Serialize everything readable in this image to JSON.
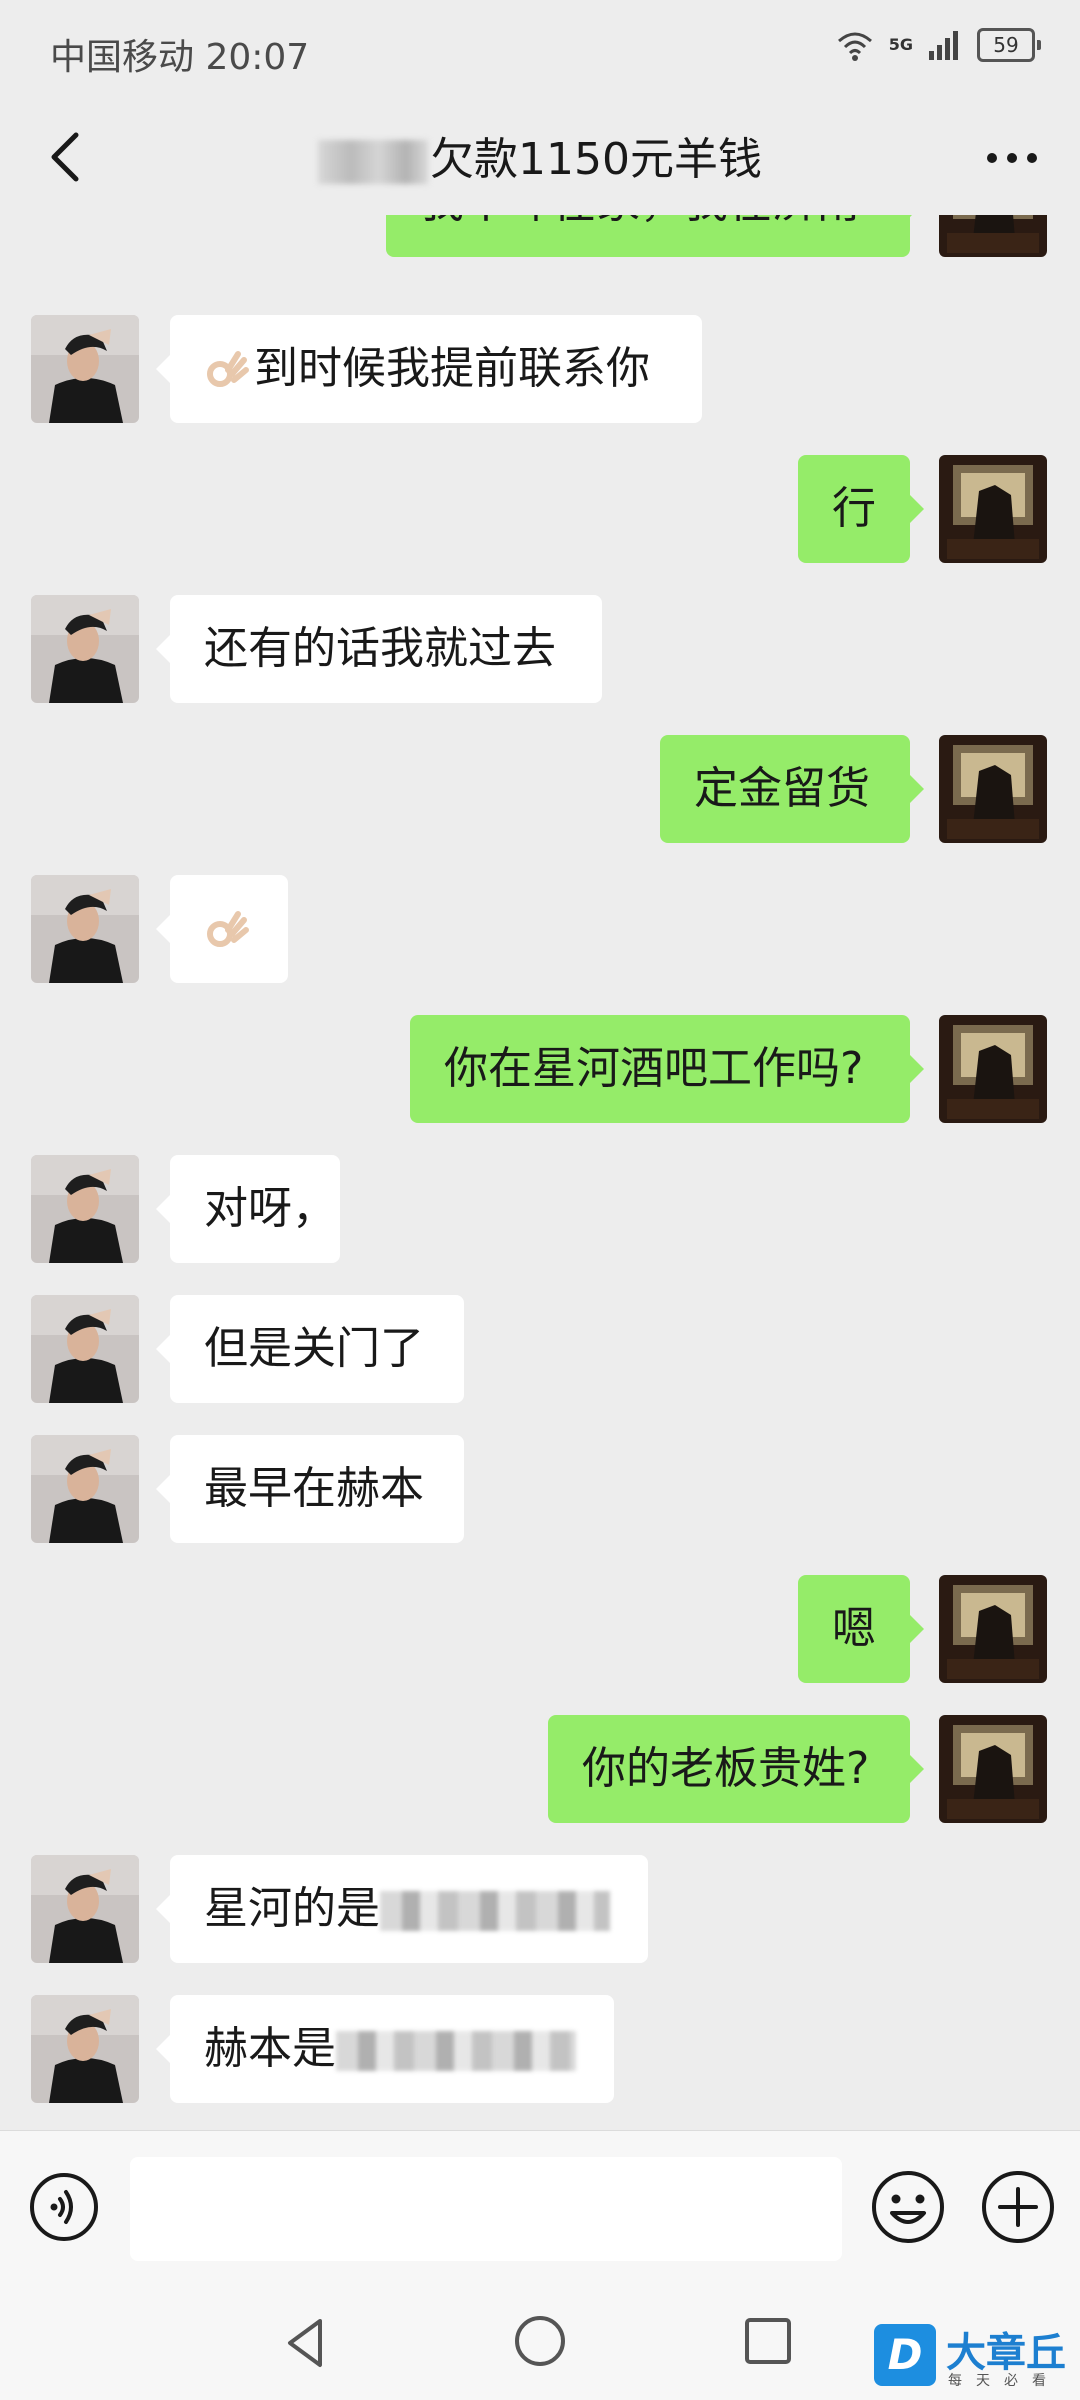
{
  "status_bar": {
    "carrier_time": "中国移动 20:07",
    "network": "5G",
    "battery": "59"
  },
  "header": {
    "title": "欠款1150元羊钱"
  },
  "messages": [
    {
      "side": "right",
      "text": "我不咋在家，我在济南"
    },
    {
      "side": "left",
      "text": "到时候我提前联系你",
      "emoji": "ok-hand"
    },
    {
      "side": "right",
      "text": "行"
    },
    {
      "side": "left",
      "text": "还有的话我就过去"
    },
    {
      "side": "right",
      "text": "定金留货"
    },
    {
      "side": "left",
      "text": "",
      "emoji": "ok-hand"
    },
    {
      "side": "right",
      "text": "你在星河酒吧工作吗?"
    },
    {
      "side": "left",
      "text": "对呀，"
    },
    {
      "side": "left",
      "text": "但是关门了"
    },
    {
      "side": "left",
      "text": "最早在赫本"
    },
    {
      "side": "right",
      "text": "嗯"
    },
    {
      "side": "right",
      "text": "你的老板贵姓?"
    },
    {
      "side": "left",
      "text": "星河的是",
      "redacted": true
    },
    {
      "side": "left",
      "text": "赫本是",
      "redacted": true
    }
  ],
  "input_bar": {
    "placeholder": ""
  },
  "watermark": {
    "name": "大章丘",
    "tagline": "每天必看"
  },
  "colors": {
    "background": "#ededed",
    "sent_bubble": "#95ec69",
    "received_bubble": "#ffffff",
    "watermark_blue": "#1d8ee0"
  }
}
